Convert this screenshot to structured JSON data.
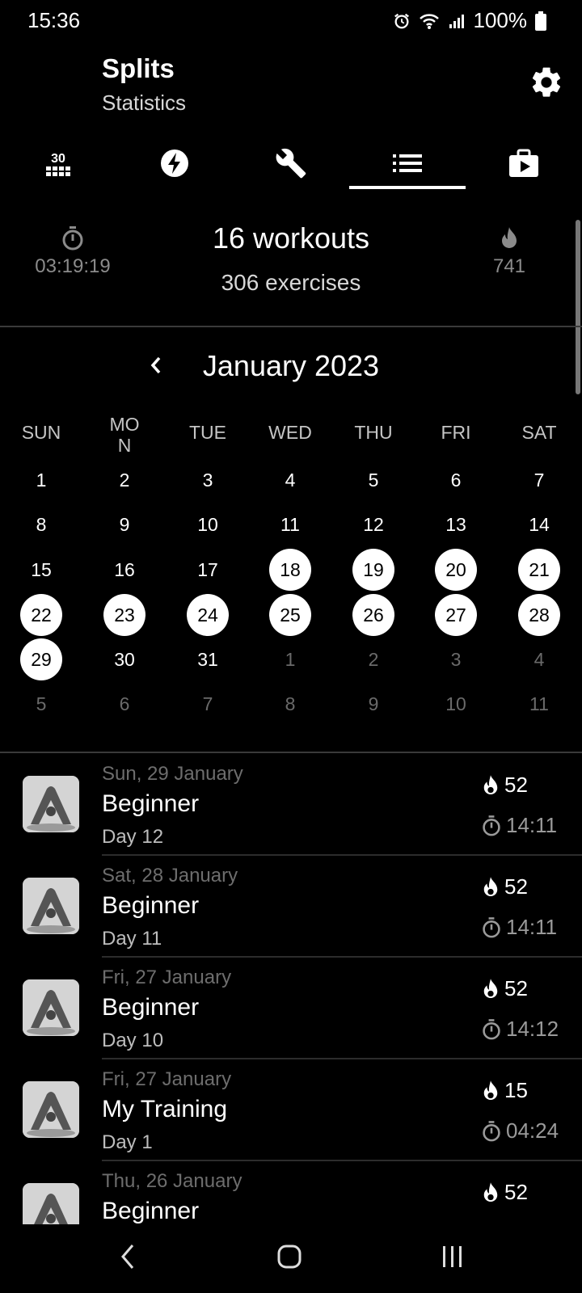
{
  "status": {
    "time": "15:36",
    "battery": "100%"
  },
  "header": {
    "title": "Splits",
    "subtitle": "Statistics"
  },
  "tabs": [
    {
      "icon": "30-day-calendar-icon"
    },
    {
      "icon": "lightning-icon"
    },
    {
      "icon": "wrench-icon"
    },
    {
      "icon": "list-icon",
      "selected": true
    },
    {
      "icon": "video-briefcase-icon"
    }
  ],
  "summary": {
    "duration": "03:19:19",
    "workouts": "16 workouts",
    "exercises": "306 exercises",
    "calories": "741"
  },
  "calendar": {
    "month": "January 2023",
    "weekdays": [
      "SUN",
      "MO\nN",
      "TUE",
      "WED",
      "THU",
      "FRI",
      "SAT"
    ],
    "weeks": [
      [
        [
          "1",
          "cur"
        ],
        [
          "2",
          "cur"
        ],
        [
          "3",
          "cur"
        ],
        [
          "4",
          "cur"
        ],
        [
          "5",
          "cur"
        ],
        [
          "6",
          "cur"
        ],
        [
          "7",
          "cur"
        ]
      ],
      [
        [
          "8",
          "cur"
        ],
        [
          "9",
          "cur"
        ],
        [
          "10",
          "cur"
        ],
        [
          "11",
          "cur"
        ],
        [
          "12",
          "cur"
        ],
        [
          "13",
          "cur"
        ],
        [
          "14",
          "cur"
        ]
      ],
      [
        [
          "15",
          "cur"
        ],
        [
          "16",
          "cur"
        ],
        [
          "17",
          "cur"
        ],
        [
          "18",
          "hl"
        ],
        [
          "19",
          "hl"
        ],
        [
          "20",
          "hl"
        ],
        [
          "21",
          "hl"
        ]
      ],
      [
        [
          "22",
          "hl"
        ],
        [
          "23",
          "hl"
        ],
        [
          "24",
          "hl"
        ],
        [
          "25",
          "hl"
        ],
        [
          "26",
          "hl"
        ],
        [
          "27",
          "hl"
        ],
        [
          "28",
          "hl"
        ]
      ],
      [
        [
          "29",
          "hl"
        ],
        [
          "30",
          "cur"
        ],
        [
          "31",
          "cur"
        ],
        [
          "1",
          "other"
        ],
        [
          "2",
          "other"
        ],
        [
          "3",
          "other"
        ],
        [
          "4",
          "other"
        ]
      ],
      [
        [
          "5",
          "other"
        ],
        [
          "6",
          "other"
        ],
        [
          "7",
          "other"
        ],
        [
          "8",
          "other"
        ],
        [
          "9",
          "other"
        ],
        [
          "10",
          "other"
        ],
        [
          "11",
          "other"
        ]
      ]
    ]
  },
  "workouts": [
    {
      "date": "Sun, 29 January",
      "name": "Beginner",
      "day": "Day 12",
      "calories": "52",
      "duration": "14:11"
    },
    {
      "date": "Sat, 28 January",
      "name": "Beginner",
      "day": "Day 11",
      "calories": "52",
      "duration": "14:11"
    },
    {
      "date": "Fri, 27 January",
      "name": "Beginner",
      "day": "Day 10",
      "calories": "52",
      "duration": "14:12"
    },
    {
      "date": "Fri, 27 January",
      "name": "My Training",
      "day": "Day 1",
      "calories": "15",
      "duration": "04:24"
    },
    {
      "date": "Thu, 26 January",
      "name": "Beginner",
      "day": "",
      "calories": "52",
      "duration": ""
    }
  ]
}
